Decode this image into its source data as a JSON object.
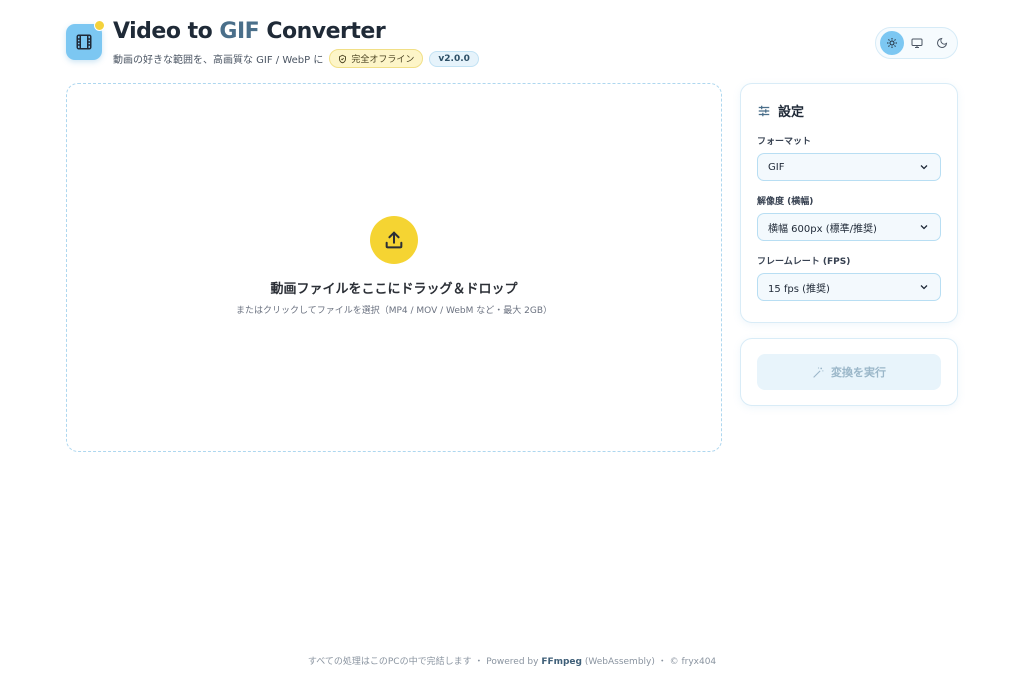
{
  "app": {
    "title_part1": "Video to ",
    "title_accent": "GIF",
    "title_part2": " Converter",
    "subtitle": "動画の好きな範囲を、高画質な GIF / WebP に",
    "offline_badge": "完全オフライン",
    "version_badge": "v2.0.0",
    "logo_icon": "film-icon"
  },
  "theme": {
    "options": [
      "sun-icon",
      "monitor-icon",
      "moon-icon"
    ],
    "active": "light"
  },
  "dropzone": {
    "title": "動画ファイルをここにドラッグ＆ドロップ",
    "subtitle": "またはクリックしてファイルを選択（MP4 / MOV / WebM など・最大 2GB）",
    "icon": "upload-icon"
  },
  "settings": {
    "title": "設定",
    "format_label": "フォーマット",
    "format_value": "GIF",
    "resolution_label": "解像度 (横幅)",
    "resolution_value": "横幅 600px (標準/推奨)",
    "fps_label": "フレームレート (FPS)",
    "fps_value": "15 fps (推奨)"
  },
  "action": {
    "run_label": "変換を実行"
  },
  "footer": {
    "text1": "すべての処理はこのPCの中で完結します ・ Powered by ",
    "ffmpeg": "FFmpeg",
    "text2": " (WebAssembly) ・ © fryx404"
  },
  "colors": {
    "accent_blue": "#7cc7f2",
    "accent_yellow": "#f5d432",
    "title_accent": "#4a6f8a"
  }
}
